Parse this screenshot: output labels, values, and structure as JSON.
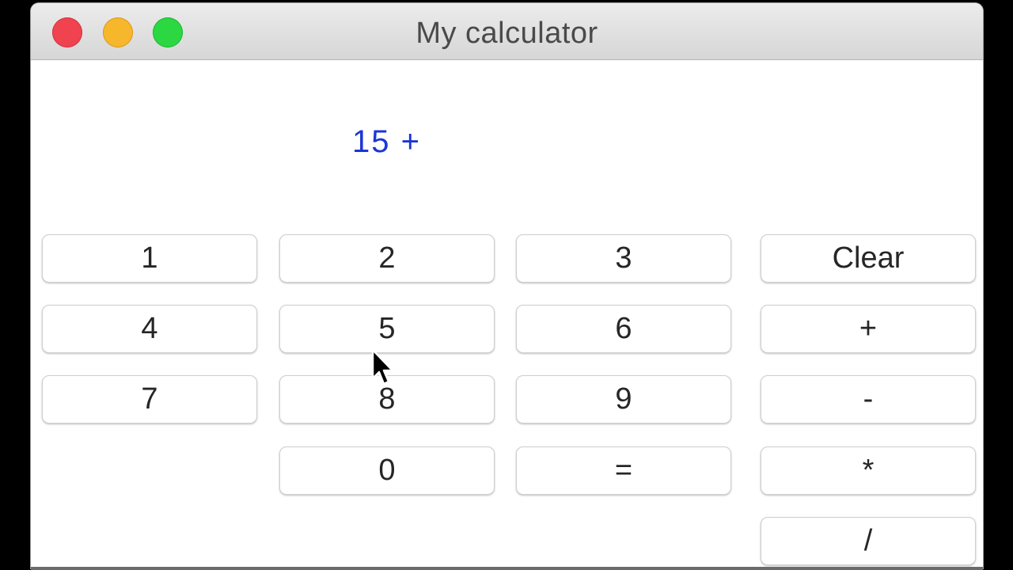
{
  "window": {
    "title": "My calculator",
    "controls": [
      "close",
      "minimize",
      "maximize"
    ],
    "colors": {
      "close": "#f0434f",
      "minimize": "#f7b72d",
      "maximize": "#2bd841"
    }
  },
  "display": {
    "expression": "15 +",
    "color": "#1c36d6"
  },
  "buttons": {
    "one": "1",
    "two": "2",
    "three": "3",
    "clear": "Clear",
    "four": "4",
    "five": "5",
    "six": "6",
    "plus": "+",
    "seven": "7",
    "eight": "8",
    "nine": "9",
    "minus": "-",
    "zero": "0",
    "equals": "=",
    "multiply": "*",
    "divide": "/"
  },
  "cursor": {
    "type": "arrow-pointer"
  }
}
